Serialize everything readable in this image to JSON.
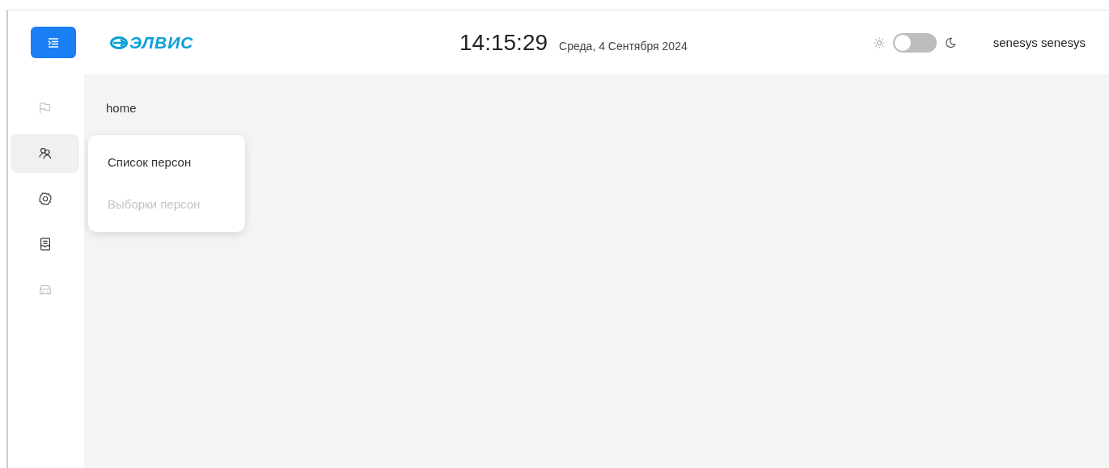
{
  "header": {
    "logo": "ЭЛВИС",
    "time": "14:15:29",
    "date": "Среда, 4 Сентября 2024",
    "dark_mode": false,
    "user": "senesys senesys"
  },
  "sidebar": {
    "items": [
      {
        "kind": "flag",
        "selected": false,
        "disabled": true
      },
      {
        "kind": "persons",
        "selected": true,
        "disabled": false
      },
      {
        "kind": "settings",
        "selected": false,
        "disabled": false
      },
      {
        "kind": "document",
        "selected": false,
        "disabled": false
      },
      {
        "kind": "car",
        "selected": false,
        "disabled": true
      }
    ]
  },
  "breadcrumb": "home",
  "menu": {
    "items": [
      {
        "label": "Список персон",
        "disabled": false
      },
      {
        "label": "Выборки персон",
        "disabled": true
      }
    ]
  }
}
